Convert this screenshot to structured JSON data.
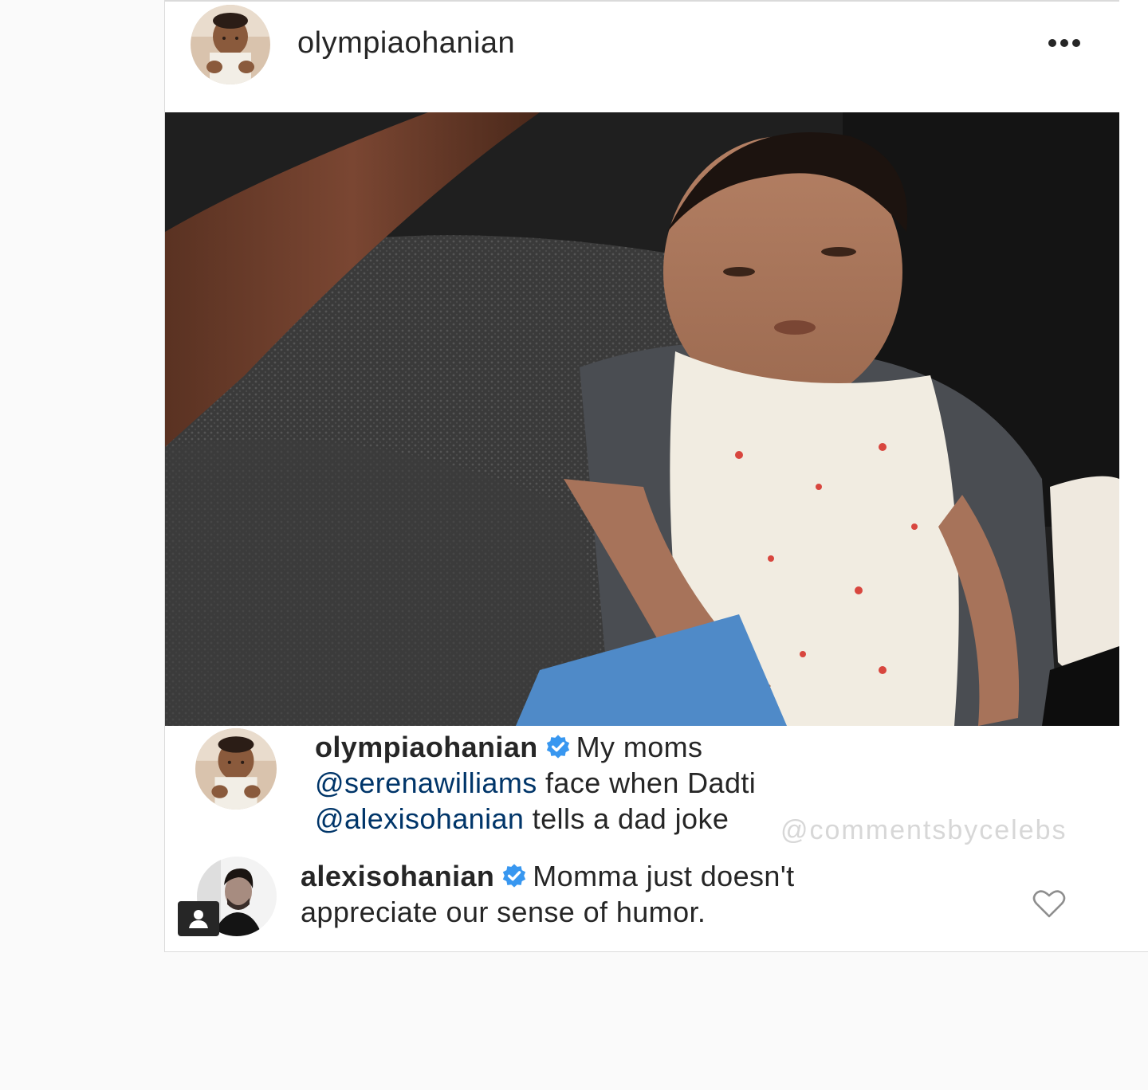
{
  "post": {
    "author": "olympiaohanian",
    "menu_icon": "more-horizontal-icon",
    "photo_alt": "baby-photo"
  },
  "caption": {
    "username": "olympiaohanian",
    "verified": true,
    "text_1": "My moms",
    "mention_1": "@serenawilliams",
    "text_2": "face when Dadti",
    "mention_2": "@alexisohanian",
    "text_3": "tells a dad joke"
  },
  "watermark": "@commentsbycelebs",
  "comment": {
    "username": "alexisohanian",
    "verified": true,
    "text_1": "Momma just doesn't",
    "text_2": "appreciate our sense of humor.",
    "like_icon": "heart-icon"
  },
  "colors": {
    "mention": "#003569",
    "verified_badge": "#3897f0",
    "text": "#262626"
  }
}
